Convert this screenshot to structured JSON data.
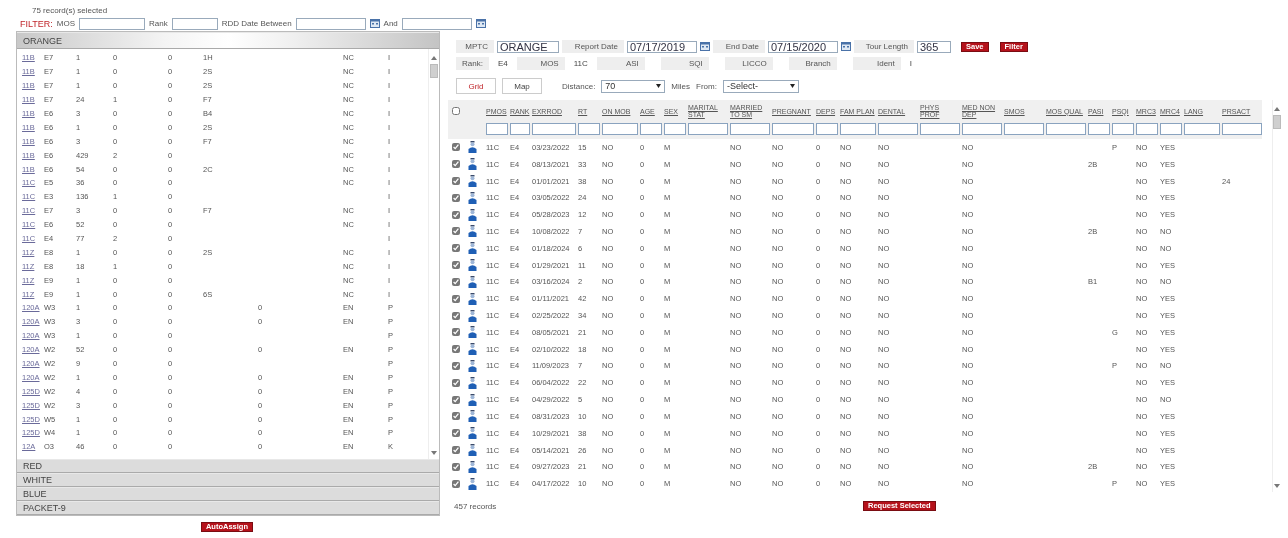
{
  "selection_count": "75 record(s) selected",
  "filter": {
    "title": "FILTER:",
    "fields": [
      {
        "label": "MOS",
        "kind": "text"
      },
      {
        "label": "Rank",
        "kind": "text"
      },
      {
        "label": "RDD Date Between",
        "kind": "date"
      },
      {
        "label": "And",
        "kind": "date"
      }
    ]
  },
  "groups": [
    {
      "label": "ORANGE",
      "expanded": true,
      "rows": [
        {
          "cells": [
            "11B",
            "E7",
            "1",
            "0",
            "0",
            "1H",
            "",
            "NC",
            "I"
          ]
        },
        {
          "cells": [
            "11B",
            "E7",
            "1",
            "0",
            "0",
            "2S",
            "",
            "NC",
            "I"
          ]
        },
        {
          "cells": [
            "11B",
            "E7",
            "1",
            "0",
            "0",
            "2S",
            "",
            "NC",
            "I"
          ]
        },
        {
          "cells": [
            "11B",
            "E7",
            "24",
            "1",
            "0",
            "F7",
            "",
            "NC",
            "I"
          ]
        },
        {
          "cells": [
            "11B",
            "E6",
            "3",
            "0",
            "0",
            "B4",
            "",
            "NC",
            "I"
          ]
        },
        {
          "cells": [
            "11B",
            "E6",
            "1",
            "0",
            "0",
            "2S",
            "",
            "NC",
            "I"
          ]
        },
        {
          "cells": [
            "11B",
            "E6",
            "3",
            "0",
            "0",
            "F7",
            "",
            "NC",
            "I"
          ]
        },
        {
          "cells": [
            "11B",
            "E6",
            "429",
            "2",
            "0",
            "",
            "",
            "NC",
            "I"
          ]
        },
        {
          "cells": [
            "11B",
            "E6",
            "54",
            "0",
            "0",
            "2C",
            "",
            "NC",
            "I"
          ]
        },
        {
          "cells": [
            "11C",
            "E5",
            "36",
            "0",
            "0",
            "",
            "",
            "NC",
            "I"
          ]
        },
        {
          "cells": [
            "11C",
            "E3",
            "136",
            "1",
            "0",
            "",
            "",
            "",
            "I"
          ]
        },
        {
          "cells": [
            "11C",
            "E7",
            "3",
            "0",
            "0",
            "F7",
            "",
            "NC",
            "I"
          ]
        },
        {
          "cells": [
            "11C",
            "E6",
            "52",
            "0",
            "0",
            "",
            "",
            "NC",
            "I"
          ]
        },
        {
          "cells": [
            "11C",
            "E4",
            "77",
            "2",
            "0",
            "",
            "",
            "",
            "I"
          ]
        },
        {
          "cells": [
            "11Z",
            "E8",
            "1",
            "0",
            "0",
            "2S",
            "",
            "NC",
            "I"
          ]
        },
        {
          "cells": [
            "11Z",
            "E8",
            "18",
            "1",
            "0",
            "",
            "",
            "NC",
            "I"
          ]
        },
        {
          "cells": [
            "11Z",
            "E9",
            "1",
            "0",
            "0",
            "",
            "",
            "NC",
            "I"
          ]
        },
        {
          "cells": [
            "11Z",
            "E9",
            "1",
            "0",
            "0",
            "6S",
            "",
            "NC",
            "I"
          ]
        },
        {
          "cells": [
            "120A",
            "W3",
            "1",
            "0",
            "0",
            "",
            "0",
            "EN",
            "P"
          ]
        },
        {
          "cells": [
            "120A",
            "W3",
            "3",
            "0",
            "0",
            "",
            "0",
            "EN",
            "P"
          ]
        },
        {
          "cells": [
            "120A",
            "W3",
            "1",
            "0",
            "0",
            "",
            "",
            "",
            "P"
          ]
        },
        {
          "cells": [
            "120A",
            "W2",
            "52",
            "0",
            "0",
            "",
            "0",
            "EN",
            "P"
          ]
        },
        {
          "cells": [
            "120A",
            "W2",
            "9",
            "0",
            "0",
            "",
            "",
            "",
            "P"
          ]
        },
        {
          "cells": [
            "120A",
            "W2",
            "1",
            "0",
            "0",
            "",
            "0",
            "EN",
            "P"
          ]
        },
        {
          "cells": [
            "125D",
            "W2",
            "4",
            "0",
            "0",
            "",
            "0",
            "EN",
            "P"
          ]
        },
        {
          "cells": [
            "125D",
            "W2",
            "3",
            "0",
            "0",
            "",
            "0",
            "EN",
            "P"
          ]
        },
        {
          "cells": [
            "125D",
            "W5",
            "1",
            "0",
            "0",
            "",
            "0",
            "EN",
            "P"
          ]
        },
        {
          "cells": [
            "125D",
            "W4",
            "1",
            "0",
            "0",
            "",
            "0",
            "EN",
            "P"
          ]
        },
        {
          "cells": [
            "12A",
            "O3",
            "46",
            "0",
            "0",
            "",
            "0",
            "EN",
            "K"
          ]
        }
      ]
    },
    {
      "label": "RED",
      "expanded": false
    },
    {
      "label": "WHITE",
      "expanded": false
    },
    {
      "label": "BLUE",
      "expanded": false
    },
    {
      "label": "PACKET-9",
      "expanded": false
    }
  ],
  "auto_assign": "AutoAssign",
  "header_fields": [
    {
      "label": "MPTC",
      "kind": "text",
      "value": "ORANGE"
    },
    {
      "label": "Report Date",
      "kind": "date",
      "value": "07/17/2019"
    },
    {
      "label": "End Date",
      "kind": "date",
      "value": "07/15/2020"
    },
    {
      "label": "Tour Length",
      "kind": "text",
      "value": "365"
    }
  ],
  "header_buttons": [
    "Save",
    "Filter"
  ],
  "profile": [
    {
      "label": "Rank:",
      "value": "E4"
    },
    {
      "label": "MOS",
      "value": "11C"
    },
    {
      "label": "ASI"
    },
    {
      "label": "SQI"
    },
    {
      "label": "LICCO"
    },
    {
      "label": "Branch"
    },
    {
      "label": "Ident",
      "value": "I"
    }
  ],
  "view_tabs": [
    {
      "label": "Grid",
      "selected": true
    },
    {
      "label": "Map",
      "selected": false
    }
  ],
  "distance": {
    "label": "Distance:",
    "value": "70",
    "unit": "Miles",
    "from_label": "From:",
    "from_value": "-Select-"
  },
  "grid": {
    "select_all": false,
    "columns": [
      "PMOS",
      "RANK",
      "EXRROD",
      "RT",
      "ON MOB",
      "AGE",
      "SEX",
      "MARITAL STAT",
      "MARRIED TO SM",
      "PREGNANT",
      "DEPS",
      "FAM PLAN",
      "DENTAL",
      "PHYS PROF",
      "MED NON DEP",
      "SMOS",
      "MOS QUAL",
      "PASI",
      "PSQI",
      "MRC3",
      "MRC4",
      "LANG",
      "PRSACT"
    ],
    "rows": [
      {
        "checked": true,
        "cells": [
          "11C",
          "E4",
          "03/23/2022",
          "15",
          "NO",
          "0",
          "M",
          "",
          "NO",
          "NO",
          "0",
          "NO",
          "NO",
          "",
          "NO",
          "",
          "",
          "",
          "P",
          "NO",
          "YES",
          "",
          ""
        ]
      },
      {
        "checked": true,
        "cells": [
          "11C",
          "E4",
          "08/13/2021",
          "33",
          "NO",
          "0",
          "M",
          "",
          "NO",
          "NO",
          "0",
          "NO",
          "NO",
          "",
          "NO",
          "",
          "",
          "2B",
          "",
          "NO",
          "YES",
          "",
          ""
        ]
      },
      {
        "checked": true,
        "cells": [
          "11C",
          "E4",
          "01/01/2021",
          "38",
          "NO",
          "0",
          "M",
          "",
          "NO",
          "NO",
          "0",
          "NO",
          "NO",
          "",
          "NO",
          "",
          "",
          "",
          "",
          "NO",
          "YES",
          "",
          "24"
        ]
      },
      {
        "checked": true,
        "cells": [
          "11C",
          "E4",
          "03/05/2022",
          "24",
          "NO",
          "0",
          "M",
          "",
          "NO",
          "NO",
          "0",
          "NO",
          "NO",
          "",
          "NO",
          "",
          "",
          "",
          "",
          "NO",
          "YES",
          "",
          ""
        ]
      },
      {
        "checked": true,
        "cells": [
          "11C",
          "E4",
          "05/28/2023",
          "12",
          "NO",
          "0",
          "M",
          "",
          "NO",
          "NO",
          "0",
          "NO",
          "NO",
          "",
          "NO",
          "",
          "",
          "",
          "",
          "NO",
          "YES",
          "",
          ""
        ]
      },
      {
        "checked": true,
        "cells": [
          "11C",
          "E4",
          "10/08/2022",
          "7",
          "NO",
          "0",
          "M",
          "",
          "NO",
          "NO",
          "0",
          "NO",
          "NO",
          "",
          "NO",
          "",
          "",
          "2B",
          "",
          "NO",
          "NO",
          "",
          ""
        ]
      },
      {
        "checked": true,
        "cells": [
          "11C",
          "E4",
          "01/18/2024",
          "6",
          "NO",
          "0",
          "M",
          "",
          "NO",
          "NO",
          "0",
          "NO",
          "NO",
          "",
          "NO",
          "",
          "",
          "",
          "",
          "NO",
          "NO",
          "",
          ""
        ]
      },
      {
        "checked": true,
        "cells": [
          "11C",
          "E4",
          "01/29/2021",
          "11",
          "NO",
          "0",
          "M",
          "",
          "NO",
          "NO",
          "0",
          "NO",
          "NO",
          "",
          "NO",
          "",
          "",
          "",
          "",
          "NO",
          "YES",
          "",
          ""
        ]
      },
      {
        "checked": true,
        "cells": [
          "11C",
          "E4",
          "03/16/2024",
          "2",
          "NO",
          "0",
          "M",
          "",
          "NO",
          "NO",
          "0",
          "NO",
          "NO",
          "",
          "NO",
          "",
          "",
          "B1",
          "",
          "NO",
          "NO",
          "",
          ""
        ]
      },
      {
        "checked": true,
        "cells": [
          "11C",
          "E4",
          "01/11/2021",
          "42",
          "NO",
          "0",
          "M",
          "",
          "NO",
          "NO",
          "0",
          "NO",
          "NO",
          "",
          "NO",
          "",
          "",
          "",
          "",
          "NO",
          "YES",
          "",
          ""
        ]
      },
      {
        "checked": true,
        "cells": [
          "11C",
          "E4",
          "02/25/2022",
          "34",
          "NO",
          "0",
          "M",
          "",
          "NO",
          "NO",
          "0",
          "NO",
          "NO",
          "",
          "NO",
          "",
          "",
          "",
          "",
          "NO",
          "YES",
          "",
          ""
        ]
      },
      {
        "checked": true,
        "cells": [
          "11C",
          "E4",
          "08/05/2021",
          "21",
          "NO",
          "0",
          "M",
          "",
          "NO",
          "NO",
          "0",
          "NO",
          "NO",
          "",
          "NO",
          "",
          "",
          "",
          "G",
          "NO",
          "YES",
          "",
          ""
        ]
      },
      {
        "checked": true,
        "cells": [
          "11C",
          "E4",
          "02/10/2022",
          "18",
          "NO",
          "0",
          "M",
          "",
          "NO",
          "NO",
          "0",
          "NO",
          "NO",
          "",
          "NO",
          "",
          "",
          "",
          "",
          "NO",
          "YES",
          "",
          ""
        ]
      },
      {
        "checked": true,
        "cells": [
          "11C",
          "E4",
          "11/09/2023",
          "7",
          "NO",
          "0",
          "M",
          "",
          "NO",
          "NO",
          "0",
          "NO",
          "NO",
          "",
          "NO",
          "",
          "",
          "",
          "P",
          "NO",
          "NO",
          "",
          ""
        ]
      },
      {
        "checked": true,
        "cells": [
          "11C",
          "E4",
          "06/04/2022",
          "22",
          "NO",
          "0",
          "M",
          "",
          "NO",
          "NO",
          "0",
          "NO",
          "NO",
          "",
          "NO",
          "",
          "",
          "",
          "",
          "NO",
          "YES",
          "",
          ""
        ]
      },
      {
        "checked": true,
        "cells": [
          "11C",
          "E4",
          "04/29/2022",
          "5",
          "NO",
          "0",
          "M",
          "",
          "NO",
          "NO",
          "0",
          "NO",
          "NO",
          "",
          "NO",
          "",
          "",
          "",
          "",
          "NO",
          "NO",
          "",
          ""
        ]
      },
      {
        "checked": true,
        "cells": [
          "11C",
          "E4",
          "08/31/2023",
          "10",
          "NO",
          "0",
          "M",
          "",
          "NO",
          "NO",
          "0",
          "NO",
          "NO",
          "",
          "NO",
          "",
          "",
          "",
          "",
          "NO",
          "YES",
          "",
          ""
        ]
      },
      {
        "checked": true,
        "cells": [
          "11C",
          "E4",
          "10/29/2021",
          "38",
          "NO",
          "0",
          "M",
          "",
          "NO",
          "NO",
          "0",
          "NO",
          "NO",
          "",
          "NO",
          "",
          "",
          "",
          "",
          "NO",
          "YES",
          "",
          ""
        ]
      },
      {
        "checked": true,
        "cells": [
          "11C",
          "E4",
          "05/14/2021",
          "26",
          "NO",
          "0",
          "M",
          "",
          "NO",
          "NO",
          "0",
          "NO",
          "NO",
          "",
          "NO",
          "",
          "",
          "",
          "",
          "NO",
          "YES",
          "",
          ""
        ]
      },
      {
        "checked": true,
        "cells": [
          "11C",
          "E4",
          "09/27/2023",
          "21",
          "NO",
          "0",
          "M",
          "",
          "NO",
          "NO",
          "0",
          "NO",
          "NO",
          "",
          "NO",
          "",
          "",
          "2B",
          "",
          "NO",
          "YES",
          "",
          ""
        ]
      },
      {
        "checked": true,
        "cells": [
          "11C",
          "E4",
          "04/17/2022",
          "10",
          "NO",
          "0",
          "M",
          "",
          "NO",
          "NO",
          "0",
          "NO",
          "NO",
          "",
          "NO",
          "",
          "",
          "",
          "P",
          "NO",
          "YES",
          "",
          ""
        ]
      }
    ]
  },
  "record_count": "457 records",
  "request_button": "Request Selected"
}
